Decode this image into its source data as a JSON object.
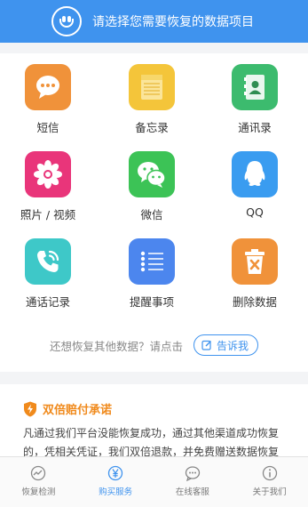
{
  "header": {
    "title": "请选择您需要恢复的数据项目"
  },
  "items": [
    {
      "label": "短信",
      "icon": "sms-icon",
      "color": "#f0923a"
    },
    {
      "label": "备忘录",
      "icon": "notes-icon",
      "color": "#f4c53a"
    },
    {
      "label": "通讯录",
      "icon": "contacts-icon",
      "color": "#3cbb6e"
    },
    {
      "label": "照片 / 视频",
      "icon": "photos-icon",
      "color": "#e9357a"
    },
    {
      "label": "微信",
      "icon": "wechat-icon",
      "color": "#3cc356"
    },
    {
      "label": "QQ",
      "icon": "qq-icon",
      "color": "#3a9cf0"
    },
    {
      "label": "通话记录",
      "icon": "call-log-icon",
      "color": "#3ec8c8"
    },
    {
      "label": "提醒事项",
      "icon": "reminders-icon",
      "color": "#4c86ee"
    },
    {
      "label": "删除数据",
      "icon": "trash-icon",
      "color": "#f0923a"
    }
  ],
  "ask": {
    "text": "还想恢复其他数据？请点击",
    "button": "告诉我"
  },
  "promise": {
    "title": "双倍赔付承诺",
    "body": "凡通过我们平台没能恢复成功，通过其他渠道成功恢复的，凭相关凭证，我们双倍退款，并免费赠送数据恢复"
  },
  "tabs": [
    {
      "label": "恢复检测",
      "icon": "detect-icon",
      "active": false
    },
    {
      "label": "购买服务",
      "icon": "yen-icon",
      "active": true
    },
    {
      "label": "在线客服",
      "icon": "chat-icon",
      "active": false
    },
    {
      "label": "关于我们",
      "icon": "info-icon",
      "active": false
    }
  ],
  "colors": {
    "accent": "#3f93ee",
    "promise": "#f08a1c"
  }
}
